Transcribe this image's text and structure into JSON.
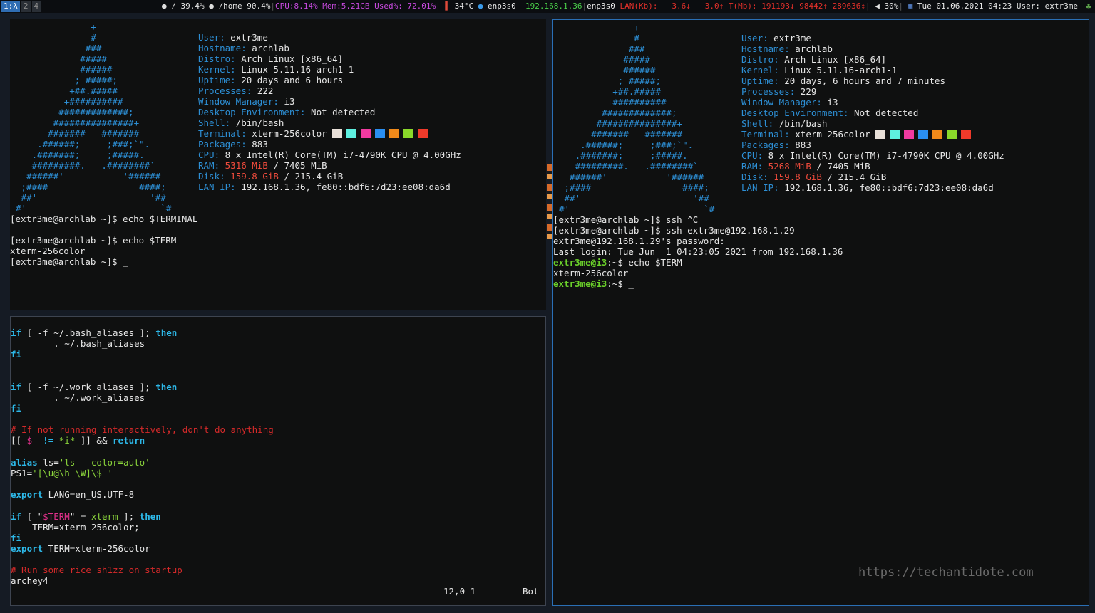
{
  "topbar": {
    "workspaces": [
      {
        "label": "1:λ",
        "active": true
      },
      {
        "label": "2",
        "active": false
      },
      {
        "label": "4",
        "active": false
      }
    ],
    "disk_root": "/ 39.4%",
    "disk_home": "/home 90.4%",
    "cpu": "CPU:8.14%",
    "mem": "Mem:5.21GB",
    "used": "Used%: 72.01%",
    "temp": "34°C",
    "iface": "enp3s0",
    "ip": "192.168.1.36",
    "iface2": "enp3s0",
    "lan_label": "LAN(Kb):",
    "lan_down": "3.6↓",
    "lan_up": "3.0↑",
    "traffic": "T(Mb): 191193↓ 98442↑ 289636↕",
    "volume": "30%",
    "datetime": "Tue 01.06.2021 04:23",
    "user": "User: extr3me"
  },
  "archey_art": [
    "              +",
    "              #",
    "             ###",
    "            #####",
    "            ######",
    "           ; #####;",
    "          +##.#####",
    "         +##########",
    "        #############;",
    "       ###############+",
    "      #######   #######",
    "    .######;     ;###;`\".",
    "   .#######;     ;#####.",
    "   #########.   .########`",
    "  ######'           '######",
    " ;####                 ####;",
    " ##'                     '##",
    "#'                         `#"
  ],
  "left_info": {
    "labels": [
      "User:",
      "Hostname:",
      "Distro:",
      "Kernel:",
      "Uptime:",
      "Processes:",
      "Window Manager:",
      "Desktop Environment:",
      "Shell:",
      "Terminal:",
      "Packages:",
      "CPU:",
      "RAM:",
      "Disk:",
      "LAN IP:"
    ],
    "user": "extr3me",
    "hostname": "archlab",
    "distro": "Arch Linux [x86_64]",
    "kernel": "Linux 5.11.16-arch1-1",
    "uptime": "20 days and 6 hours",
    "processes": "222",
    "wm": "i3",
    "de": "Not detected",
    "shell": "/bin/bash",
    "terminal": "xterm-256color",
    "packages": "883",
    "cpu": "8 x Intel(R) Core(TM) i7-4790K CPU @ 4.00GHz",
    "ram_used": "5316 MiB",
    "ram_total": "/ 7405 MiB",
    "disk_used": "159.8 GiB",
    "disk_total": "/ 215.4 GiB",
    "lan_ip": "192.168.1.36, fe80::bdf6:7d23:ee08:da6d"
  },
  "right_info": {
    "user": "extr3me",
    "hostname": "archlab",
    "distro": "Arch Linux [x86_64]",
    "kernel": "Linux 5.11.16-arch1-1",
    "uptime": "20 days, 6 hours and 7 minutes",
    "processes": "229",
    "wm": "i3",
    "de": "Not detected",
    "shell": "/bin/bash",
    "terminal": "xterm-256color",
    "packages": "883",
    "cpu": "8 x Intel(R) Core(TM) i7-4790K CPU @ 4.00GHz",
    "ram_used": "5268 MiB",
    "ram_total": "/ 7405 MiB",
    "disk_used": "159.8 GiB",
    "disk_total": "/ 215.4 GiB",
    "lan_ip": "192.168.1.36, fe80::bdf6:7d23:ee08:da6d"
  },
  "swatch_colors": [
    "#e8e0d8",
    "#5ef0e0",
    "#f03aa0",
    "#2a8ef0",
    "#f08a1a",
    "#8ad82a",
    "#ef3a2a"
  ],
  "left_shell": [
    "[extr3me@archlab ~]$ echo $TERMINAL",
    "",
    "[extr3me@archlab ~]$ echo $TERM",
    "xterm-256color",
    "[extr3me@archlab ~]$ _"
  ],
  "right_shell": {
    "l1": "[extr3me@archlab ~]$ ssh ^C",
    "l2": "[extr3me@archlab ~]$ ssh extr3me@192.168.1.29",
    "l3": "extr3me@192.168.1.29's password:",
    "l4": "Last login: Tue Jun  1 04:23:05 2021 from 192.168.1.36",
    "prompt_user": "extr3me@i3",
    "prompt_rest": ":~$ ",
    "cmd": "echo $TERM",
    "out": "xterm-256color",
    "cursor": "_"
  },
  "vim": {
    "pos": "12,0-1",
    "scroll": "Bot",
    "l_if1_a": "if",
    "l_if1_b": " [ -f ~/.bash_aliases ]; ",
    "then": "then",
    "l_src1": "        . ~/.bash_aliases",
    "fi": "fi",
    "l_if2_b": " [ -f ~/.work_aliases ]; ",
    "l_src2": "        . ~/.work_aliases",
    "comment1": "# If not running interactively, don't do anything",
    "l_test_a": "[[ ",
    "l_test_var": "$-",
    "l_test_op": " != ",
    "l_test_glob": "*i*",
    "l_test_b": " ]] && ",
    "return": "return",
    "alias_kw": "alias",
    "alias_rest": " ls=",
    "alias_val": "'ls --color=auto'",
    "ps1_a": "PS1=",
    "ps1_val": "'[\\u@\\h \\W]\\$ '",
    "export_kw": "export",
    "export1": " LANG=en_US.UTF-8",
    "if3_b": " [ \"",
    "if3_var": "$TERM",
    "if3_c": "\" = ",
    "if3_val": "xterm",
    "if3_d": " ]; ",
    "term_set": "    TERM=xterm-256color;",
    "export2": " TERM=xterm-256color",
    "comment2": "# Run some rice sh1zz on startup",
    "archey": "archey4"
  },
  "watermark": "https://techantidote.com"
}
